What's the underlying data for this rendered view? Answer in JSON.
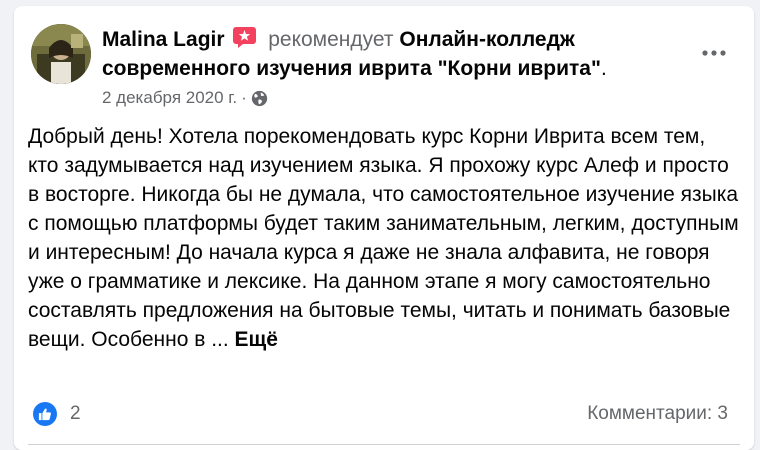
{
  "post": {
    "author": "Malina Lagir",
    "verb": "рекомендует",
    "page_name": "Онлайн-колледж современного изучения иврита \"Корни иврита\"",
    "punct": ".",
    "date": "2 декабря 2020 г.",
    "separator": "·",
    "body": "Добрый день! Хотела порекомендовать курс Корни Иврита всем тем, кто задумывается над изучением языка. Я прохожу курс Алеф и просто в восторге. Никогда бы не думала, что самостоятельное изучение языка с помощью платформы будет таким занимательным, легким, доступным и интересным! До начала курса я даже не знала алфавита, не говоря уже о грамматике и лексике. На данном этапе я могу самостоятельно составлять предложения на бытовые темы, читать и понимать базовые вещи. Особенно в ...",
    "more_label": "Ещё"
  },
  "footer": {
    "likes": "2",
    "comments": "Комментарии: 3"
  },
  "icons": {
    "recommend": "recommend-icon",
    "privacy": "globe-icon",
    "more": "more-horizontal-icon",
    "like": "thumbs-up-icon"
  },
  "colors": {
    "text": "#050505",
    "secondary": "#65676b",
    "like_blue": "#1877f2",
    "recommend_red": "#f3425f"
  }
}
